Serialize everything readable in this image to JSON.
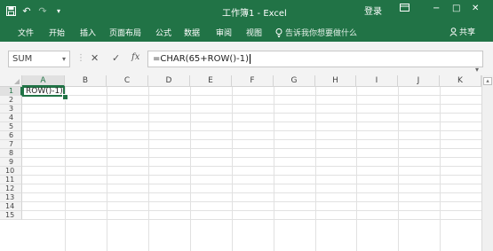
{
  "titlebar": {
    "title": "工作簿1 - Excel",
    "login": "登录",
    "ribbon_options_icon": "ribbon-display-icon",
    "window_controls": {
      "minimize": "−",
      "maximize": "□",
      "close": "✕"
    }
  },
  "quick_access": {
    "save": "save-icon",
    "undo": "↶",
    "redo": "↷",
    "customize": "▾"
  },
  "ribbon_tabs": [
    "文件",
    "开始",
    "插入",
    "页面布局",
    "公式",
    "数据",
    "审阅",
    "视图"
  ],
  "tell_me": "告诉我你想要做什么",
  "share": "共享",
  "formula_bar": {
    "name_box": "SUM",
    "cancel": "✕",
    "enter": "✓",
    "fx": "fx",
    "formula": "=CHAR(65+ROW()-1)"
  },
  "grid": {
    "columns": [
      "A",
      "B",
      "C",
      "D",
      "E",
      "F",
      "G",
      "H",
      "I",
      "J",
      "K"
    ],
    "rows": [
      "1",
      "2",
      "3",
      "4",
      "5",
      "6",
      "7",
      "8",
      "9",
      "10",
      "11",
      "12",
      "13",
      "14",
      "15"
    ],
    "active_cell_text": "ROW()-1)",
    "selected_column": "A",
    "selected_row": "1"
  },
  "colors": {
    "accent": "#217346",
    "header_bg": "#f3f3f3",
    "gridline": "#e1e1e1"
  }
}
